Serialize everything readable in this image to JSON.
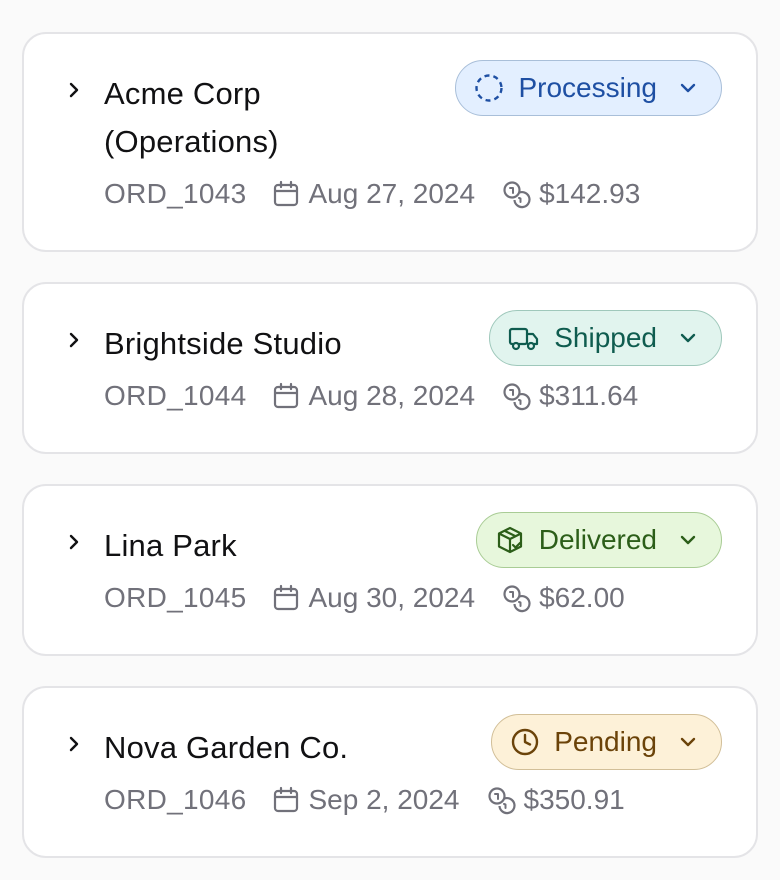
{
  "orders": [
    {
      "customer": "Acme Corp (Operations)",
      "order_id": "ORD_1043",
      "date": "Aug 27, 2024",
      "amount": "$142.93",
      "status": {
        "label": "Processing",
        "icon": "dashed-circle-icon",
        "text_color": "#1e4fa3",
        "bg_color": "#e3efff",
        "border_color": "#a9bfd9"
      }
    },
    {
      "customer": "Brightside Studio",
      "order_id": "ORD_1044",
      "date": "Aug 28, 2024",
      "amount": "$311.64",
      "status": {
        "label": "Shipped",
        "icon": "truck-icon",
        "text_color": "#0f5c4f",
        "bg_color": "#e1f4ee",
        "border_color": "#9fc8bb"
      }
    },
    {
      "customer": "Lina Park",
      "order_id": "ORD_1045",
      "date": "Aug 30, 2024",
      "amount": "$62.00",
      "status": {
        "label": "Delivered",
        "icon": "package-check-icon",
        "text_color": "#2c5e19",
        "bg_color": "#e7f7dc",
        "border_color": "#a9cc95"
      }
    },
    {
      "customer": "Nova Garden Co.",
      "order_id": "ORD_1046",
      "date": "Sep 2, 2024",
      "amount": "$350.91",
      "status": {
        "label": "Pending",
        "icon": "clock-icon",
        "text_color": "#6b4309",
        "bg_color": "#fdf1d8",
        "border_color": "#d2bf98"
      }
    }
  ]
}
